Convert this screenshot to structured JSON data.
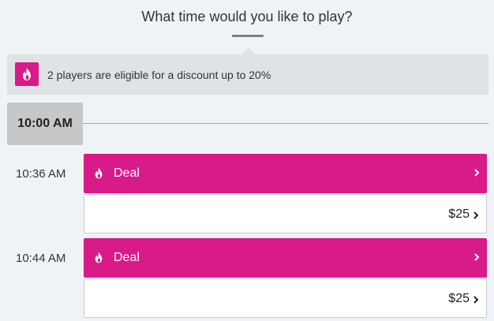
{
  "header": {
    "question": "What time would you like to play?"
  },
  "banner": {
    "icon": "flame-icon",
    "text": "2 players are eligible for a discount up to 20%"
  },
  "hour_group": {
    "label": "10:00 AM"
  },
  "slots": [
    {
      "time": "10:36 AM",
      "deal_label": "Deal",
      "price": "$25"
    },
    {
      "time": "10:44 AM",
      "deal_label": "Deal",
      "price": "$25"
    }
  ],
  "colors": {
    "accent": "#d81b88",
    "background": "#f0f3f6",
    "banner": "#dfe3e6",
    "hour_chip": "#c5c7c9"
  }
}
